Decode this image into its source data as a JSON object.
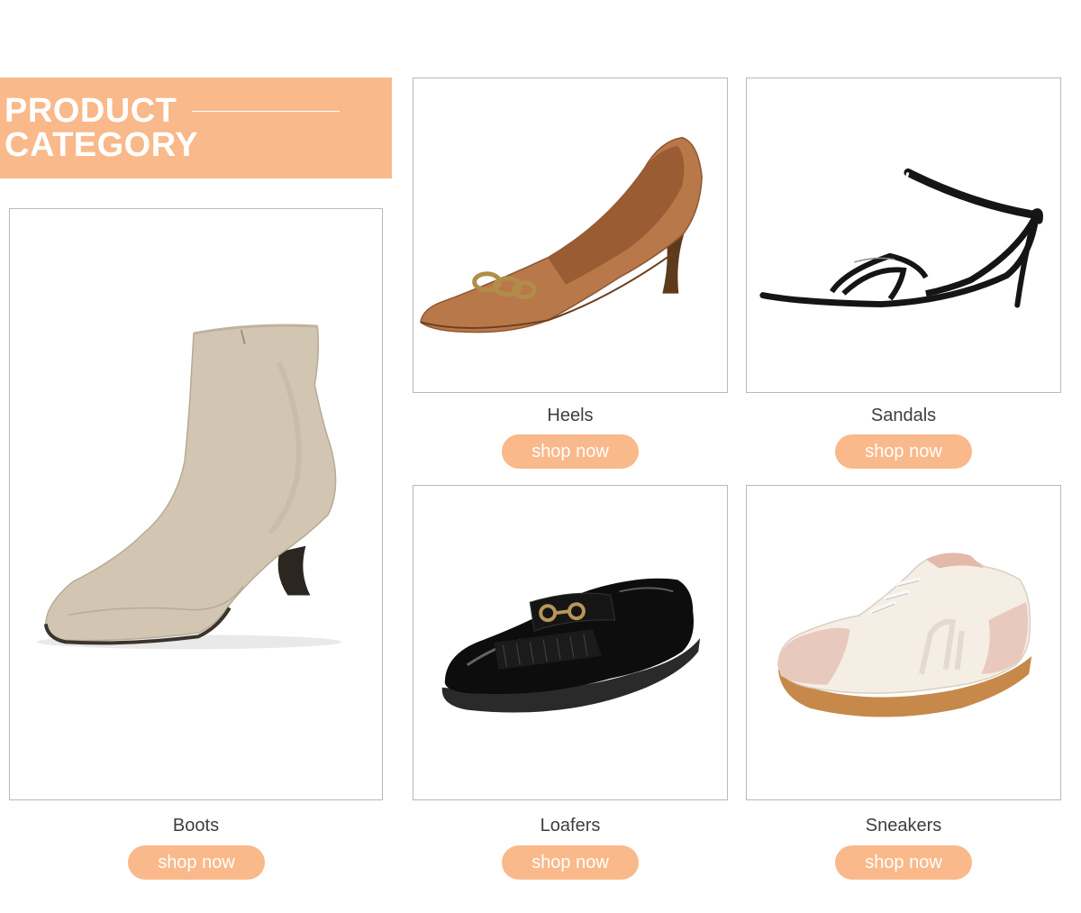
{
  "header": {
    "title_line1": "PRODUCT",
    "title_line2": "CATEGORY"
  },
  "colors": {
    "accent": "#f9b98a",
    "card_border": "#b9b9b9",
    "label_text": "#3e3e3e"
  },
  "categories": {
    "boots": {
      "name": "Boots",
      "cta": "shop now",
      "image": "ankle-boot-image"
    },
    "heels": {
      "name": "Heels",
      "cta": "shop now",
      "image": "pump-heel-image"
    },
    "sandals": {
      "name": "Sandals",
      "cta": "shop now",
      "image": "strappy-sandal-image"
    },
    "loafers": {
      "name": "Loafers",
      "cta": "shop now",
      "image": "patent-loafer-image"
    },
    "sneakers": {
      "name": "Sneakers",
      "cta": "shop now",
      "image": "sneaker-image"
    }
  }
}
